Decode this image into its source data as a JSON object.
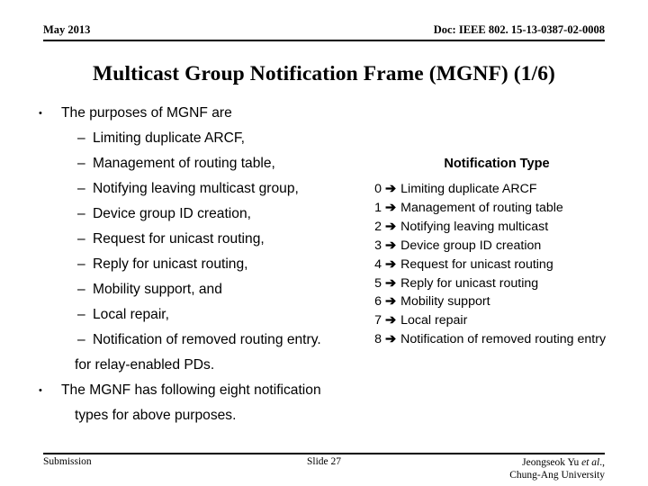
{
  "header": {
    "date": "May 2013",
    "doc": "Doc: IEEE 802. 15-13-0387-02-0008"
  },
  "title": "Multicast Group Notification Frame (MGNF) (1/6)",
  "body": {
    "bullet1": {
      "mark": "•",
      "text": "The purposes of MGNF are"
    },
    "sub_mark": "–",
    "sub_items": [
      "Limiting duplicate ARCF,",
      "Management of routing table,",
      "Notifying leaving multicast group,",
      "Device group ID creation,",
      "Request for unicast routing,",
      "Reply for unicast routing,",
      "Mobility support, and",
      "Local repair,",
      "Notification of removed routing entry."
    ],
    "continuation": "for relay-enabled PDs.",
    "bullet2": {
      "mark": "•",
      "line1": "The MGNF has following eight notification",
      "line2": "types for above purposes."
    }
  },
  "notification_type": {
    "title": "Notification Type",
    "arrow": "➔",
    "rows": [
      {
        "code": "0",
        "label": "Limiting duplicate ARCF"
      },
      {
        "code": "1",
        "label": "Management of routing table"
      },
      {
        "code": "2",
        "label": "Notifying leaving multicast"
      },
      {
        "code": "3",
        "label": "Device group ID creation"
      },
      {
        "code": "4",
        "label": "Request for unicast routing"
      },
      {
        "code": "5",
        "label": "Reply for unicast routing"
      },
      {
        "code": "6",
        "label": "Mobility support"
      },
      {
        "code": "7",
        "label": "Local repair"
      },
      {
        "code": "8",
        "label": "Notification of removed routing entry"
      }
    ]
  },
  "footer": {
    "left": "Submission",
    "center": "Slide 27",
    "right_line1_pre": "Jeongseok Yu ",
    "right_line1_ital": "et al",
    "right_line1_post": ".,",
    "right_line2": "Chung-Ang University"
  }
}
